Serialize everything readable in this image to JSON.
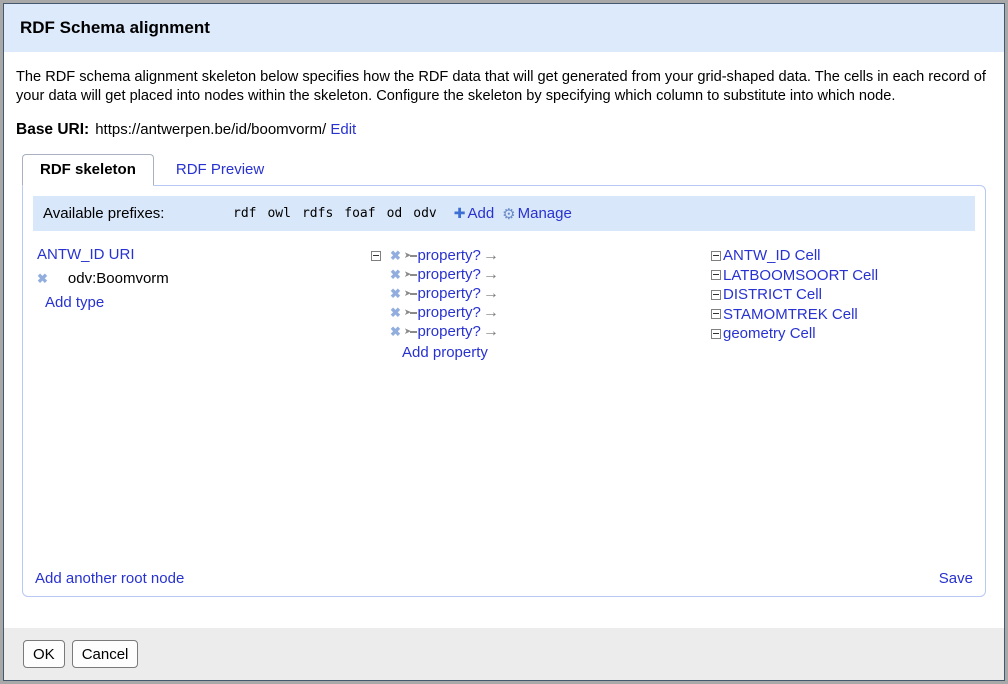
{
  "dialog": {
    "title": "RDF Schema alignment",
    "description": "The RDF schema alignment skeleton below specifies how the RDF data that will get generated from your grid-shaped data. The cells in each record of your data will get placed into nodes within the skeleton. Configure the skeleton by specifying which column to substitute into which node.",
    "base_uri": {
      "label": "Base URI:",
      "value": "https://antwerpen.be/id/boomvorm/",
      "edit_label": "Edit"
    }
  },
  "tabs": [
    {
      "label": "RDF skeleton",
      "active": true
    },
    {
      "label": "RDF Preview",
      "active": false
    }
  ],
  "prefix_bar": {
    "label": "Available prefixes:",
    "prefixes": [
      "rdf",
      "owl",
      "rdfs",
      "foaf",
      "od",
      "odv"
    ],
    "add_label": "Add",
    "manage_label": "Manage"
  },
  "skeleton": {
    "root_node": {
      "label": "ANTW_ID URI",
      "type": {
        "label": "odv:Boomvorm"
      },
      "add_type_label": "Add type"
    },
    "property_rows": [
      {
        "label": "property?"
      },
      {
        "label": "property?"
      },
      {
        "label": "property?"
      },
      {
        "label": "property?"
      },
      {
        "label": "property?"
      }
    ],
    "add_property_label": "Add property",
    "cell_nodes": [
      {
        "label": "ANTW_ID Cell"
      },
      {
        "label": "LATBOOMSOORT Cell"
      },
      {
        "label": "DISTRICT Cell"
      },
      {
        "label": "STAMOMTREK Cell"
      },
      {
        "label": "geometry Cell"
      }
    ]
  },
  "panel_links": {
    "add_root_node": "Add another root node",
    "save": "Save"
  },
  "footer_buttons": {
    "ok": "OK",
    "cancel": "Cancel"
  },
  "icons": {
    "plus": "✚",
    "gear": "⚙",
    "x": "✖",
    "arrow_tail": "➤",
    "arrow_head": "→"
  },
  "colors": {
    "link": "#2832d0",
    "titlebar_bg": "#ddeafb",
    "prefix_bar_bg": "#d9e7fa",
    "delete_x": "#92aede",
    "arrow_gray": "#8a8a8a"
  }
}
